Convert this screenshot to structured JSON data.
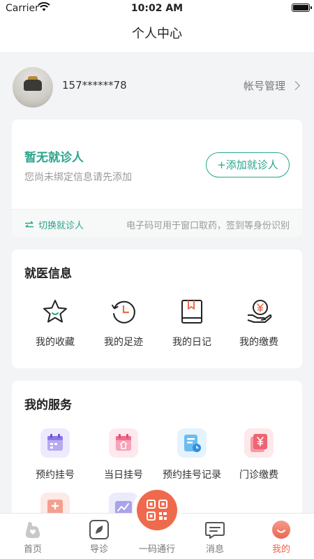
{
  "status_bar": {
    "carrier": "Carrier",
    "time": "10:02 AM"
  },
  "nav": {
    "title": "个人中心"
  },
  "profile": {
    "phone": "157******78",
    "account_manage": "帐号管理"
  },
  "patient_card": {
    "title": "暂无就诊人",
    "hint": "您尚未绑定信息请先添加",
    "add_button": "+添加就诊人",
    "switch_label": "切换就诊人",
    "footer_tip": "电子码可用于窗口取药，签到等身份识别"
  },
  "medical_info": {
    "title": "就医信息",
    "items": [
      {
        "label": "我的收藏",
        "icon": "star-icon"
      },
      {
        "label": "我的足迹",
        "icon": "history-clock-icon"
      },
      {
        "label": "我的日记",
        "icon": "diary-book-icon"
      },
      {
        "label": "我的缴费",
        "icon": "payment-yen-icon"
      }
    ]
  },
  "services": {
    "title": "我的服务",
    "items": [
      {
        "label": "预约挂号",
        "icon": "calendar-appointment-icon"
      },
      {
        "label": "当日挂号",
        "icon": "calendar-today-icon"
      },
      {
        "label": "预约挂号记录",
        "icon": "appointment-record-icon"
      },
      {
        "label": "门诊缴费",
        "icon": "outpatient-payment-icon"
      },
      {
        "label": "",
        "icon": "medical-kit-icon"
      },
      {
        "label": "",
        "icon": "report-chart-icon"
      }
    ]
  },
  "tabbar": {
    "items": [
      {
        "label": "首页",
        "icon": "home-heart-icon"
      },
      {
        "label": "导诊",
        "icon": "compass-guide-icon"
      },
      {
        "label": "一码通行",
        "icon": "qr-code-icon"
      },
      {
        "label": "消息",
        "icon": "message-icon"
      },
      {
        "label": "我的",
        "icon": "profile-smile-icon"
      }
    ],
    "active_index": 4
  },
  "colors": {
    "accent": "#29a58c",
    "brand_orange": "#ef6a4c"
  }
}
